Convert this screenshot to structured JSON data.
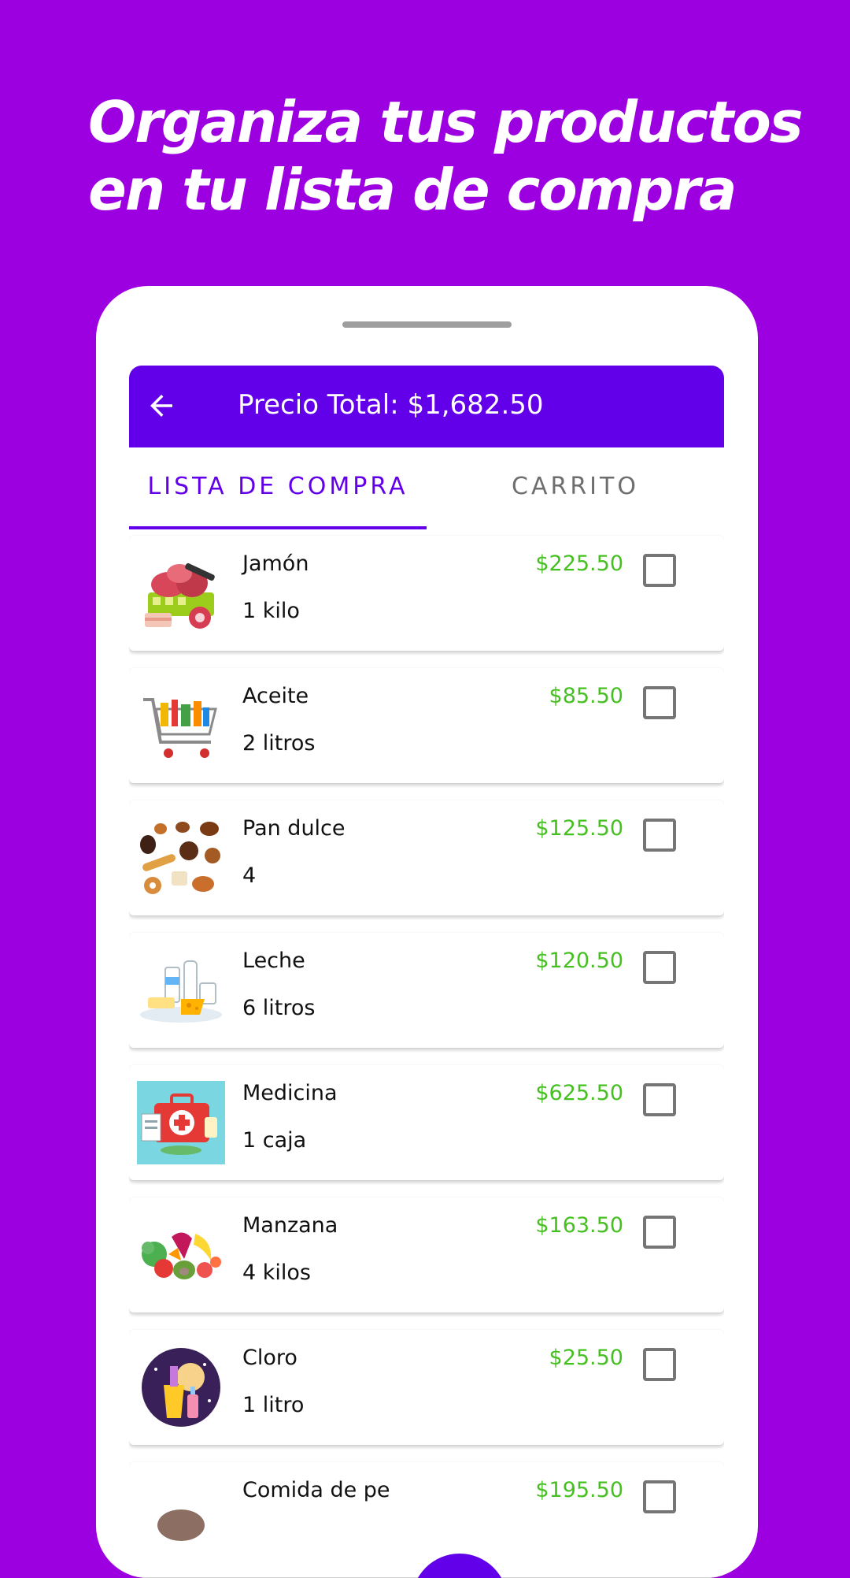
{
  "headline": {
    "line1": "Organiza tus productos",
    "line2": "en tu lista de compra"
  },
  "appbar": {
    "back_icon": "arrow-left-icon",
    "title": "Precio Total: $1,682.50"
  },
  "tabs": [
    {
      "label": "LISTA DE COMPRA",
      "selected": true
    },
    {
      "label": "CARRITO",
      "selected": false
    }
  ],
  "items": [
    {
      "name": "Jamón",
      "quantity": "1 kilo",
      "price": "$225.50",
      "checked": false,
      "image": "meat-basket"
    },
    {
      "name": "Aceite",
      "quantity": "2 litros",
      "price": "$85.50",
      "checked": false,
      "image": "shopping-cart"
    },
    {
      "name": "Pan dulce",
      "quantity": "4",
      "price": "$125.50",
      "checked": false,
      "image": "pastries"
    },
    {
      "name": "Leche",
      "quantity": "6 litros",
      "price": "$120.50",
      "checked": false,
      "image": "dairy"
    },
    {
      "name": "Medicina",
      "quantity": "1 caja",
      "price": "$625.50",
      "checked": false,
      "image": "first-aid-kit"
    },
    {
      "name": "Manzana",
      "quantity": "4 kilos",
      "price": "$163.50",
      "checked": false,
      "image": "fruits-vegetables"
    },
    {
      "name": "Cloro",
      "quantity": "1 litro",
      "price": "$25.50",
      "checked": false,
      "image": "cleaning-supplies"
    },
    {
      "name": "Comida de pe",
      "quantity": "",
      "price": "$195.50",
      "checked": false,
      "image": "pet-food"
    }
  ],
  "colors": {
    "background": "#9d00e0",
    "primary": "#6200ea",
    "price": "#45c021"
  }
}
